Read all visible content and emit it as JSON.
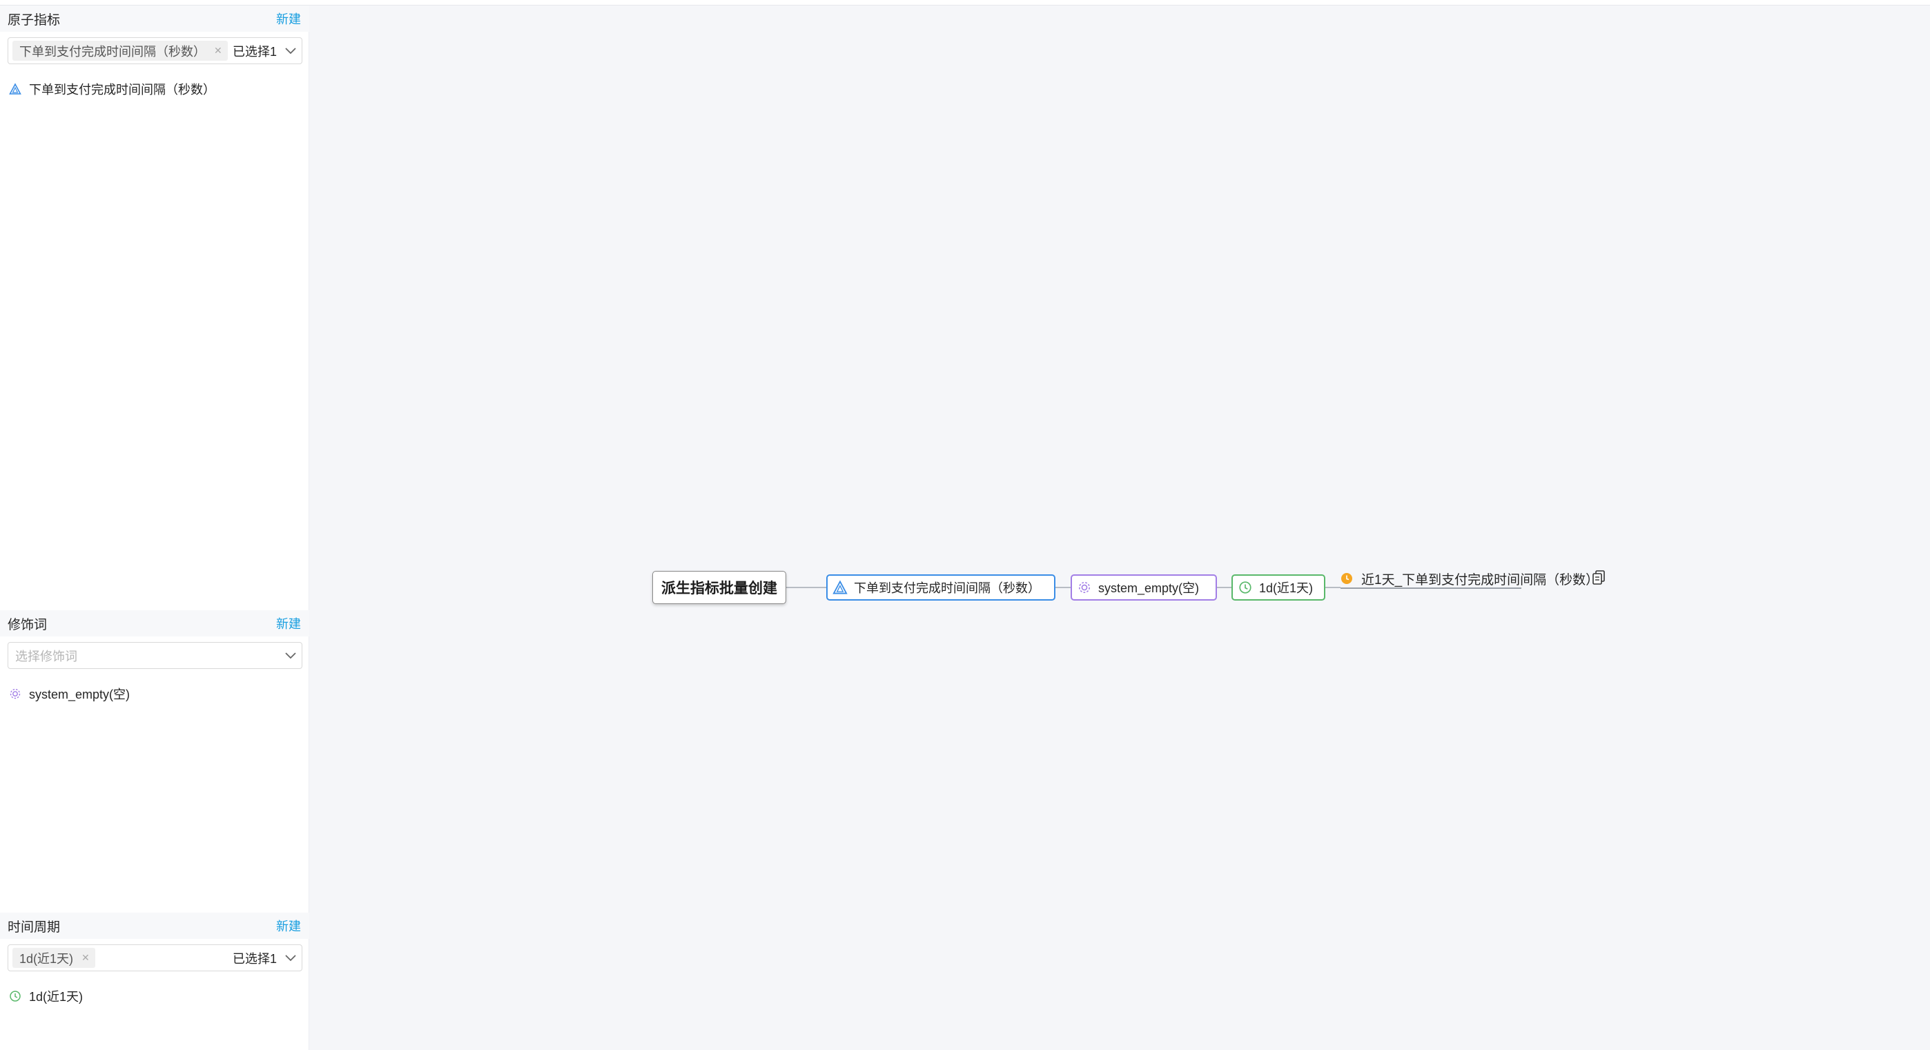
{
  "sections": {
    "atomic": {
      "title": "原子指标",
      "new_label": "新建",
      "selected_tag": "下单到支付完成时间间隔（秒数）",
      "selected_count": "已选择1",
      "items": [
        "下单到支付完成时间间隔（秒数）"
      ]
    },
    "modifier": {
      "title": "修饰词",
      "new_label": "新建",
      "placeholder": "选择修饰词",
      "items": [
        "system_empty(空)"
      ]
    },
    "period": {
      "title": "时间周期",
      "new_label": "新建",
      "selected_tag": "1d(近1天)",
      "selected_count": "已选择1",
      "items": [
        "1d(近1天)"
      ]
    }
  },
  "graph": {
    "root": "派生指标批量创建",
    "atomic_node": "下单到支付完成时间间隔（秒数）",
    "modifier_node": "system_empty(空)",
    "period_node": "1d(近1天)",
    "result": "近1天_下单到支付完成时间间隔（秒数）"
  },
  "icons": {
    "atomic": "triangle-icon",
    "modifier": "gear-icon",
    "period": "clock-icon",
    "result": "clock-warning-icon",
    "copy": "copy-icon"
  },
  "colors": {
    "link": "#1a9fe0",
    "atomic": "#3a8de6",
    "modifier": "#a27ee6",
    "period": "#59b86a",
    "result": "#f5a623"
  }
}
